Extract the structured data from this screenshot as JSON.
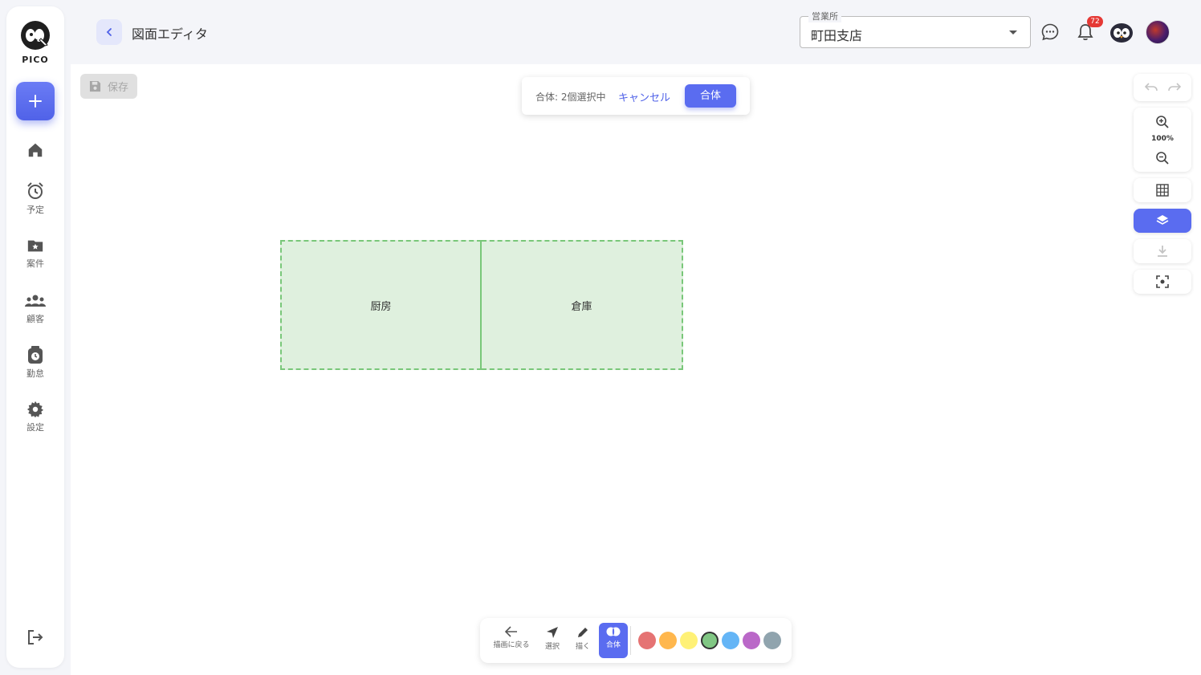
{
  "sidebar": {
    "logo_text": "PICO",
    "items": [
      {
        "label": ""
      },
      {
        "label": "予定"
      },
      {
        "label": "案件"
      },
      {
        "label": "顧客"
      },
      {
        "label": "勤怠"
      },
      {
        "label": "設定"
      }
    ]
  },
  "header": {
    "title": "図面エディタ",
    "branch_legend": "営業所",
    "branch_value": "町田支店",
    "notification_count": "72"
  },
  "toolbar": {
    "save_label": "保存"
  },
  "merge": {
    "status": "合体: 2個選択中",
    "cancel_label": "キャンセル",
    "confirm_label": "合体"
  },
  "rooms": [
    {
      "label": "厨房"
    },
    {
      "label": "倉庫"
    }
  ],
  "zoom": {
    "level": "100%"
  },
  "bottom_tools": [
    {
      "label": "描画に戻る"
    },
    {
      "label": "選択"
    },
    {
      "label": "描く"
    },
    {
      "label": "合体"
    }
  ],
  "colors": {
    "accent": "#5a6cf0",
    "room_fill": "#dff0de",
    "room_border": "#79c779",
    "palette": [
      "#e57373",
      "#ffb74d",
      "#fff176",
      "#81c784",
      "#64b5f6",
      "#ba68c8",
      "#90a4ae"
    ],
    "selected_swatch": "#81c784"
  }
}
